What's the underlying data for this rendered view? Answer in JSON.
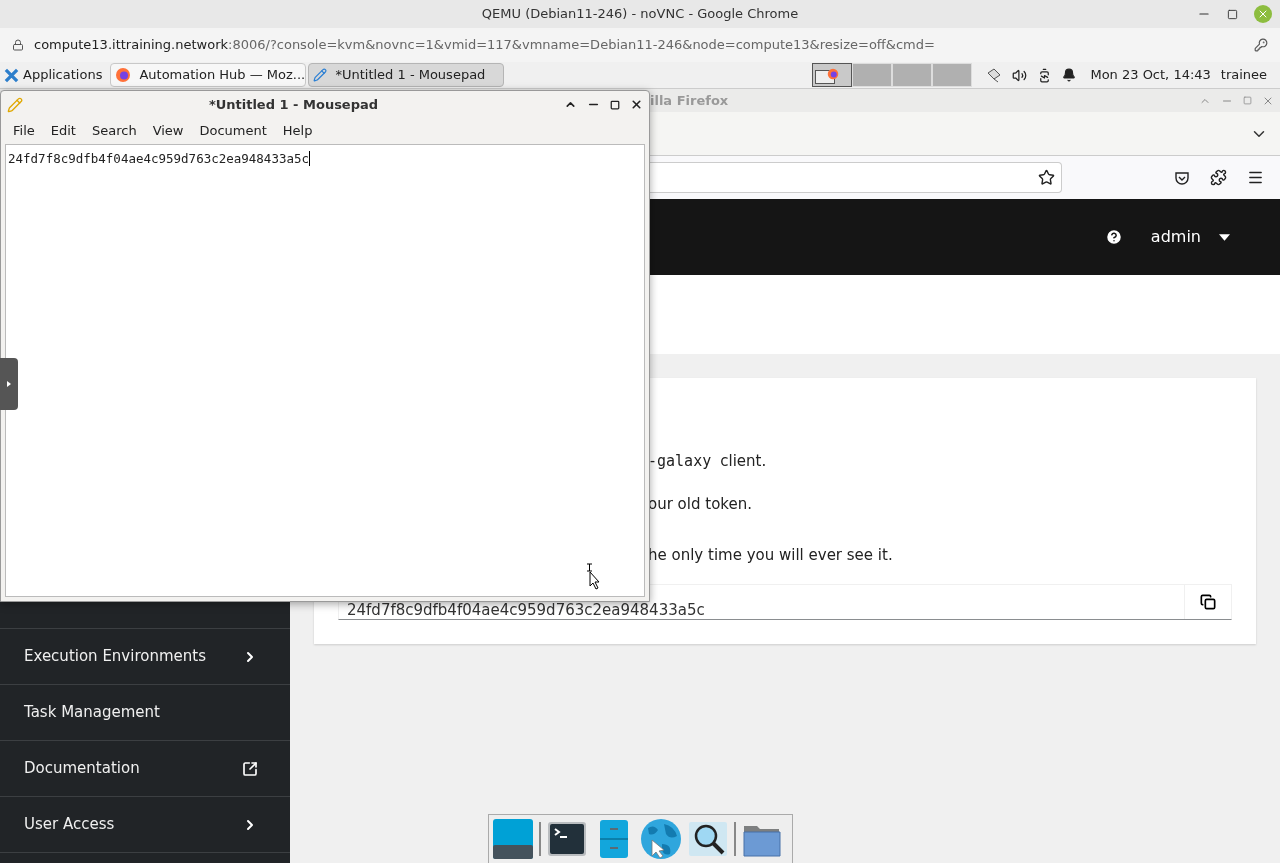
{
  "browser": {
    "title": "QEMU (Debian11-246) - noVNC - Google Chrome",
    "url_host": "compute13.ittraining.network",
    "url_rest": ":8006/?console=kvm&novnc=1&vmid=117&vmname=Debian11-246&node=compute13&resize=off&cmd="
  },
  "panel": {
    "menu_label": "Applications",
    "tasks": [
      {
        "label": "Automation Hub — Moz...",
        "kind": "browser",
        "selected": false
      },
      {
        "label": "*Untitled 1 - Mousepad",
        "kind": "editor",
        "selected": true
      }
    ],
    "workspaces": [
      {
        "selected": true,
        "has_windows": true
      },
      {
        "selected": false,
        "has_windows": false
      },
      {
        "selected": false,
        "has_windows": false
      },
      {
        "selected": false,
        "has_windows": false
      }
    ],
    "clock": "Mon 23 Oct, 14:43",
    "user": "trainee"
  },
  "firefox": {
    "title": "illa Firefox",
    "header": {
      "user": "admin"
    },
    "sidebar": {
      "items": [
        {
          "label": "Execution Environments",
          "kind": "submenu"
        },
        {
          "label": "Task Management",
          "kind": "plain"
        },
        {
          "label": "Documentation",
          "kind": "external"
        },
        {
          "label": "User Access",
          "kind": "submenu"
        }
      ]
    },
    "card": {
      "lines": [
        {
          "code": "-galaxy",
          "text": "client."
        },
        {
          "text": "our old token."
        },
        {
          "text": "he only time you will ever see it."
        }
      ],
      "token": "24fd7f8c9dfb4f04ae4c959d763c2ea948433a5c"
    }
  },
  "mousepad": {
    "title": "*Untitled 1 - Mousepad",
    "menu": [
      "File",
      "Edit",
      "Search",
      "View",
      "Document",
      "Help"
    ],
    "text": "24fd7f8c9dfb4f04ae4c959d763c2ea948433a5c"
  },
  "dock": {
    "items": [
      {
        "kind": "desktop",
        "separator_before": false
      },
      {
        "kind": "terminal",
        "separator_before": true
      },
      {
        "kind": "files",
        "separator_before": false
      },
      {
        "kind": "browser",
        "separator_before": false
      },
      {
        "kind": "search",
        "separator_before": false
      },
      {
        "kind": "folder",
        "separator_before": true
      }
    ]
  }
}
